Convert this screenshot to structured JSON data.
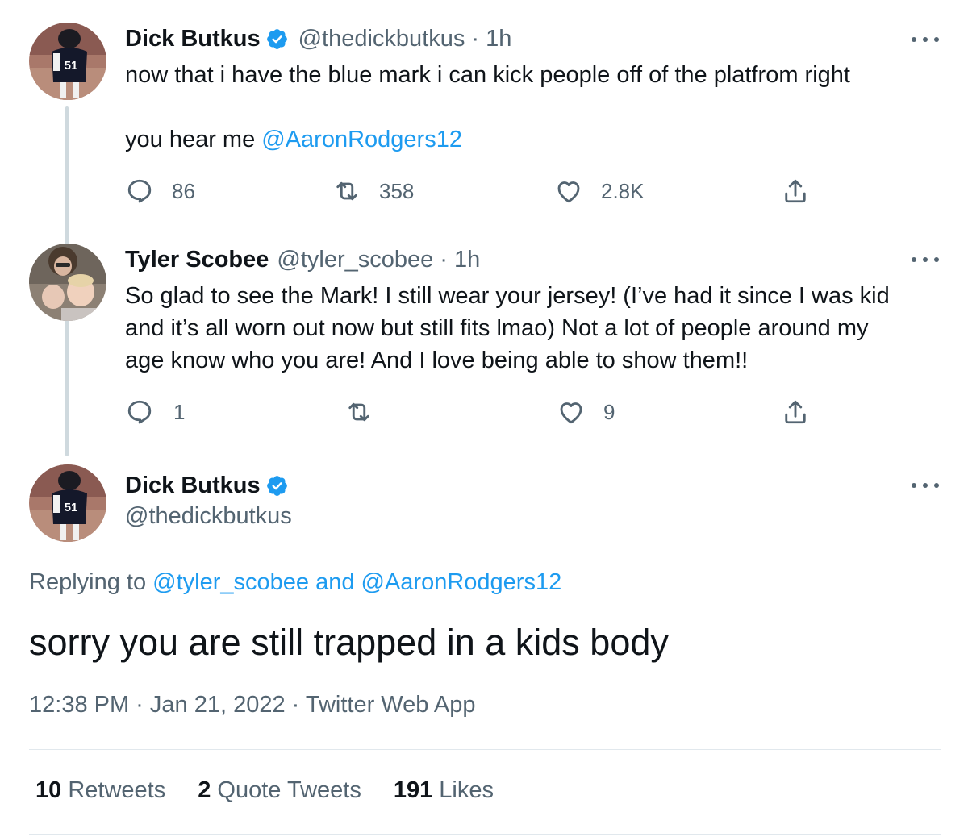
{
  "tweet1": {
    "name": "Dick Butkus",
    "handle": "@thedickbutkus",
    "separator": "·",
    "time": "1h",
    "text_line1": "now that i have the blue mark i can kick people off of the platfrom right",
    "text_line2_prefix": "you hear me ",
    "mention": "@AaronRodgers12",
    "reply_count": "86",
    "retweet_count": "358",
    "like_count": "2.8K"
  },
  "tweet2": {
    "name": "Tyler Scobee",
    "handle": "@tyler_scobee",
    "separator": "·",
    "time": "1h",
    "text_line1": "So glad to see the Mark! I still wear your jersey! (I’ve had it since I was kid",
    "text_line2": "and it’s all worn out now but still fits lmao) Not a lot of people around my",
    "text_line3": "age know who you are! And I love being able to show them!!",
    "reply_count": "1",
    "retweet_count": "",
    "like_count": "9"
  },
  "main_tweet": {
    "name": "Dick Butkus",
    "handle": "@thedickbutkus",
    "replying_prefix": "Replying to ",
    "replying_mentions": "@tyler_scobee and @AaronRodgers12",
    "text": "sorry you are still trapped in a kids body",
    "timestamp": "12:38 PM · Jan 21, 2022 · Twitter Web App",
    "retweets_num": "10",
    "retweets_label": "Retweets",
    "quotes_num": "2",
    "quotes_label": "Quote Tweets",
    "likes_num": "191",
    "likes_label": "Likes"
  },
  "jersey_number": "51",
  "colors": {
    "accent_blue": "#1d9bf0",
    "text_primary": "#0f1419",
    "text_secondary": "#536471",
    "thread_line": "#cfd9de",
    "divider": "#e1e8ed"
  },
  "icons": [
    "verified-badge-icon",
    "more-icon",
    "reply-icon",
    "retweet-icon",
    "like-icon",
    "share-icon"
  ]
}
